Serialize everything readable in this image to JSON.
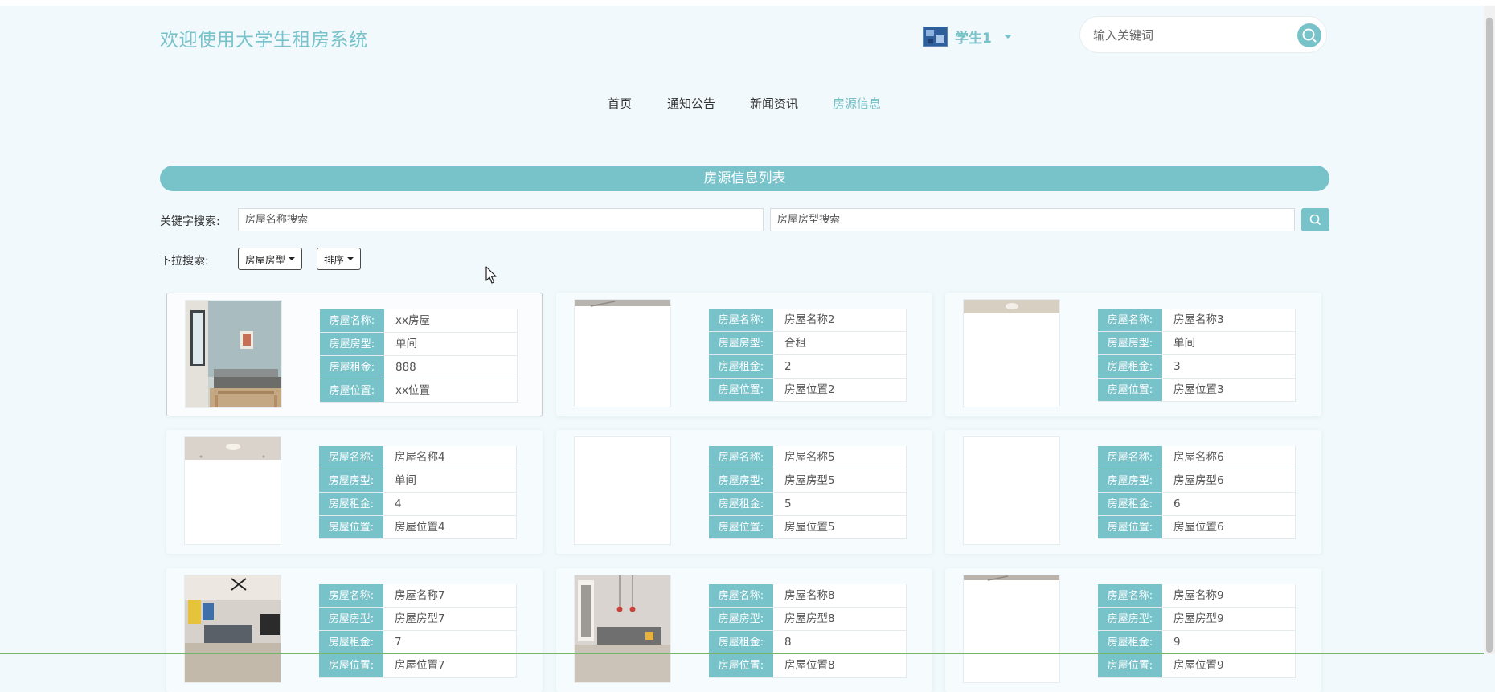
{
  "header": {
    "site_title": "欢迎使用大学生租房系统",
    "username": "学生1",
    "search_placeholder": "输入关键词",
    "avatar_icon": "user-avatar-icon",
    "search_icon": "search-icon"
  },
  "nav": {
    "items": [
      {
        "label": "首页",
        "active": false
      },
      {
        "label": "通知公告",
        "active": false
      },
      {
        "label": "新闻资讯",
        "active": false
      },
      {
        "label": "房源信息",
        "active": true
      }
    ]
  },
  "listing": {
    "banner_title": "房源信息列表",
    "keyword_label": "关键字搜索:",
    "name_placeholder": "房屋名称搜索",
    "type_placeholder": "房屋房型搜索",
    "dropdown_label": "下拉搜索:",
    "dropdowns": [
      {
        "label": "房屋房型"
      },
      {
        "label": "排序"
      }
    ]
  },
  "field_labels": {
    "name": "房屋名称:",
    "type": "房屋房型:",
    "rent": "房屋租金:",
    "location": "房屋位置:"
  },
  "houses": [
    {
      "name": "xx房屋",
      "type": "单间",
      "rent": "888",
      "location": "xx位置"
    },
    {
      "name": "房屋名称2",
      "type": "合租",
      "rent": "2",
      "location": "房屋位置2"
    },
    {
      "name": "房屋名称3",
      "type": "单间",
      "rent": "3",
      "location": "房屋位置3"
    },
    {
      "name": "房屋名称4",
      "type": "单间",
      "rent": "4",
      "location": "房屋位置4"
    },
    {
      "name": "房屋名称5",
      "type": "房屋房型5",
      "rent": "5",
      "location": "房屋位置5"
    },
    {
      "name": "房屋名称6",
      "type": "房屋房型6",
      "rent": "6",
      "location": "房屋位置6"
    },
    {
      "name": "房屋名称7",
      "type": "房屋房型7",
      "rent": "7",
      "location": "房屋位置7"
    },
    {
      "name": "房屋名称8",
      "type": "房屋房型8",
      "rent": "8",
      "location": "房屋位置8"
    },
    {
      "name": "房屋名称9",
      "type": "房屋房型9",
      "rent": "9",
      "location": "房屋位置9"
    }
  ],
  "colors": {
    "accent": "#78c2ca",
    "background": "#f1f9fc"
  }
}
